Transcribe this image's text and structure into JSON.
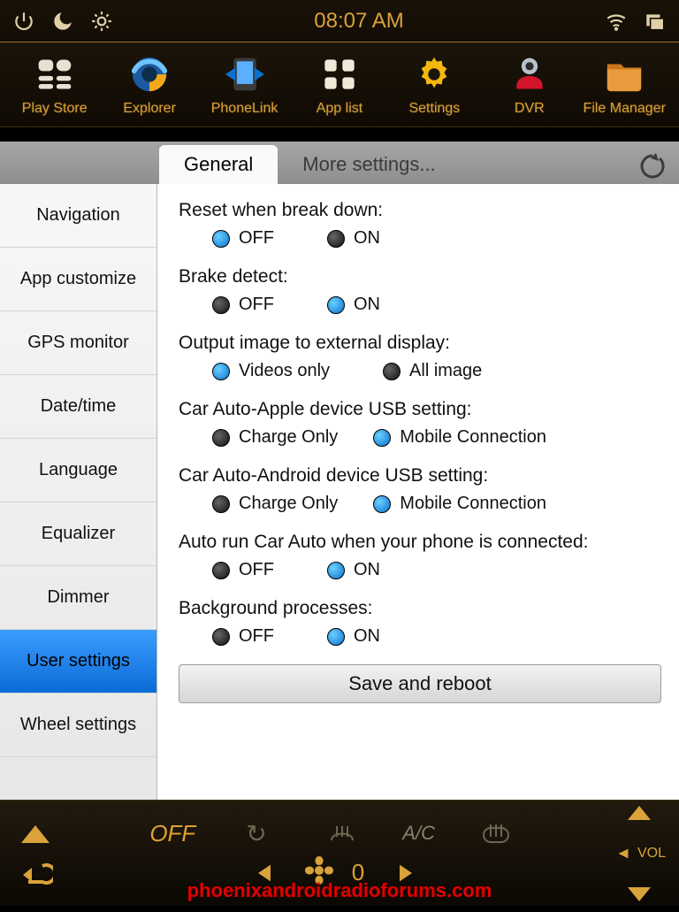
{
  "statusbar": {
    "time": "08:07 AM"
  },
  "launcher": [
    {
      "label": "Play Store",
      "icon": "playstore"
    },
    {
      "label": "Explorer",
      "icon": "globe"
    },
    {
      "label": "PhoneLink",
      "icon": "phonelink"
    },
    {
      "label": "App list",
      "icon": "grid"
    },
    {
      "label": "Settings",
      "icon": "gear"
    },
    {
      "label": "DVR",
      "icon": "dvr"
    },
    {
      "label": "File Manager",
      "icon": "folder"
    }
  ],
  "tabs": {
    "active": "General",
    "other": "More settings..."
  },
  "sidebar": [
    "Navigation",
    "App customize",
    "GPS monitor",
    "Date/time",
    "Language",
    "Equalizer",
    "Dimmer",
    "User settings",
    "Wheel settings"
  ],
  "sidebar_active_index": 7,
  "settings": [
    {
      "label": "Reset when break down:",
      "options": [
        "OFF",
        "ON"
      ],
      "selected": 0
    },
    {
      "label": "Brake detect:",
      "options": [
        "OFF",
        "ON"
      ],
      "selected": 1
    },
    {
      "label": "Output image to external display:",
      "options": [
        "Videos only",
        "All image"
      ],
      "selected": 0
    },
    {
      "label": "Car Auto-Apple device USB setting:",
      "options": [
        "Charge Only",
        "Mobile Connection"
      ],
      "selected": 1,
      "narrow": true
    },
    {
      "label": "Car Auto-Android device USB setting:",
      "options": [
        "Charge Only",
        "Mobile Connection"
      ],
      "selected": 1,
      "narrow": true
    },
    {
      "label": "Auto run Car Auto when your phone is connected:",
      "options": [
        "OFF",
        "ON"
      ],
      "selected": 1
    },
    {
      "label": "Background processes:",
      "options": [
        "OFF",
        "ON"
      ],
      "selected": 1
    }
  ],
  "save_button": "Save and reboot",
  "dock": {
    "off": "OFF",
    "ac": "A/C",
    "vol": "VOL",
    "fan_level": "0"
  },
  "watermark": "phoenixandroidradioforums.com"
}
